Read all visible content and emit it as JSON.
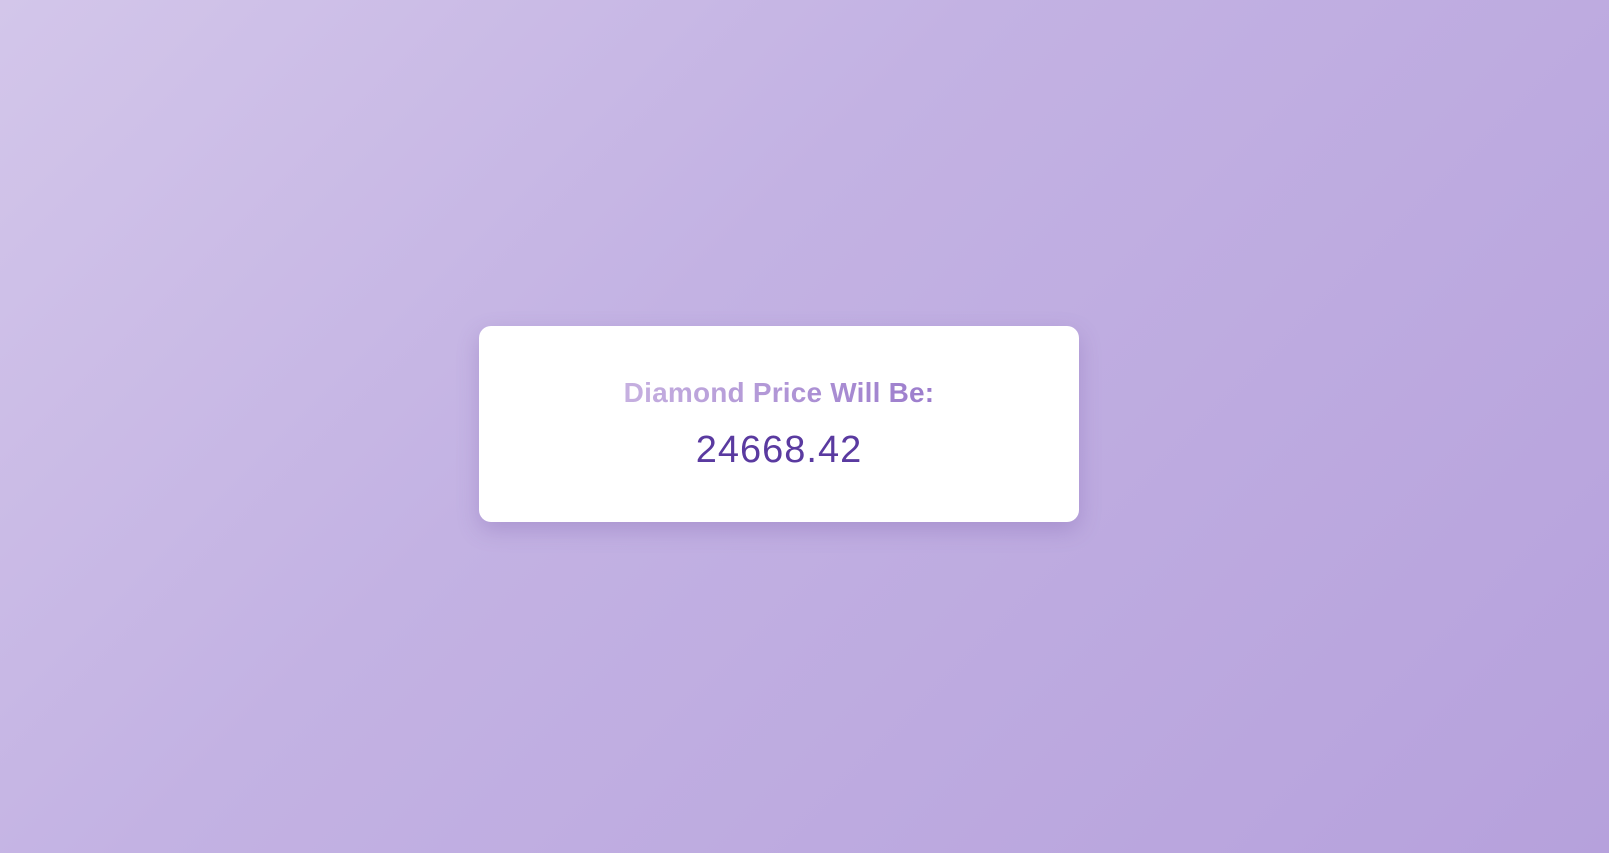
{
  "result": {
    "title": "Diamond Price Will Be:",
    "value": "24668.42"
  },
  "colors": {
    "background_start": "#d3c6ea",
    "background_end": "#b6a1dc",
    "card": "#ffffff",
    "title_start": "#c6b0e0",
    "title_end": "#9b7ccc",
    "value": "#5a3aa0"
  }
}
